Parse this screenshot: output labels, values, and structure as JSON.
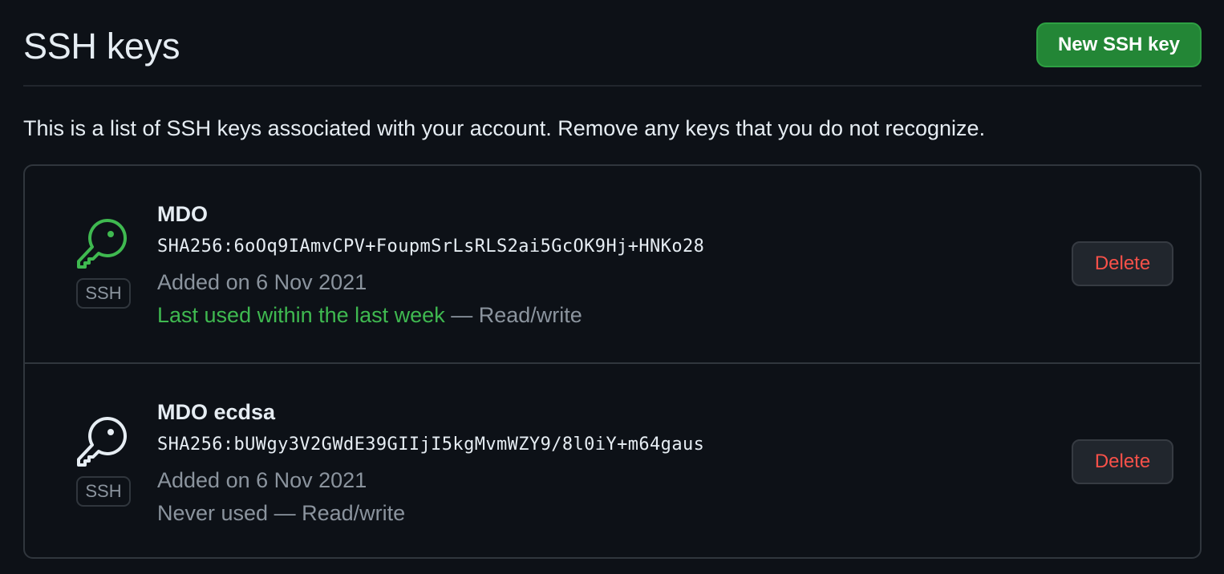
{
  "header": {
    "title": "SSH keys",
    "new_key_label": "New SSH key"
  },
  "intro_text": "This is a list of SSH keys associated with your account. Remove any keys that you do not recognize.",
  "keys": [
    {
      "title": "MDO",
      "fingerprint": "SHA256:6oOq9IAmvCPV+FoupmSrLsRLS2ai5GcOK9Hj+HNKo28",
      "added": "Added on 6 Nov 2021",
      "usage_recent": "Last used within the last week",
      "usage_access": " — Read/write",
      "badge": "SSH",
      "icon": "key-icon",
      "icon_color": "#3fb950",
      "delete_label": "Delete"
    },
    {
      "title": "MDO ecdsa",
      "fingerprint": "SHA256:bUWgy3V2GWdE39GIIjI5kgMvmWZY9/8l0iY+m64gaus",
      "added": "Added on 6 Nov 2021",
      "usage_text": "Never used — Read/write",
      "badge": "SSH",
      "icon": "key-icon",
      "icon_color": "#e6edf3",
      "delete_label": "Delete"
    }
  ],
  "colors": {
    "background": "#0d1117",
    "primary_button": "#238636",
    "danger_text": "#f85149",
    "success_text": "#3fb950",
    "muted_text": "#8b949e"
  }
}
